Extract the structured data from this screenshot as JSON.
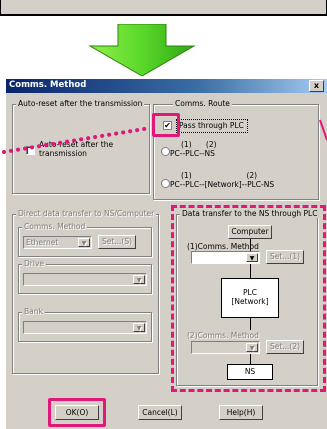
{
  "dialog": {
    "title": "Comms. Method",
    "close_glyph": "x"
  },
  "auto_reset": {
    "group_label": "Auto-reset after the transmission",
    "checkbox_label_line1": "Auto-reset after the",
    "checkbox_label_line2": "transmission"
  },
  "comms_route": {
    "group_label": "Comms. Route",
    "option1_label": "Pass through PLC",
    "option1_checked_glyph": "✔",
    "option2_nums": "(1)      (2)",
    "option2_label": "PC--PLC--NS",
    "option3_nums": "(1)                       (2)",
    "option3_label": "PC--PLC--[Network]--PLC-NS"
  },
  "direct_transfer": {
    "group_label": "Direct data transfer to NS/Computer",
    "comms_method_label": "Comms. Method",
    "comms_method_value": "Ethernet",
    "set_button": "Set...(S)",
    "drive_label": "Drive",
    "bank_label": "Bank"
  },
  "through_plc": {
    "group_label": "Data transfer to the NS through PLC",
    "computer_label": "Computer",
    "comms_method1_label": "(1)Comms. Method",
    "set1_button": "Set...(1)",
    "plc_line1": "PLC",
    "plc_line2": "[Network]",
    "comms_method2_label": "(2)Comms. Method",
    "set2_button": "Set...(2)",
    "ns_label": "NS"
  },
  "footer": {
    "ok": "OK(O)",
    "cancel": "Cancel(L)",
    "help": "Help(H)"
  },
  "colors": {
    "highlight": "#e0187a",
    "arrow": "#5ad82a"
  }
}
